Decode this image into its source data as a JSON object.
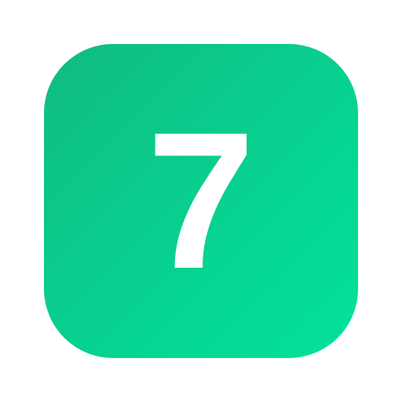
{
  "icon": {
    "label": "7",
    "background_gradient_start": "#11bb83",
    "background_gradient_end": "#02e39d",
    "glyph_color": "#ffffff"
  }
}
